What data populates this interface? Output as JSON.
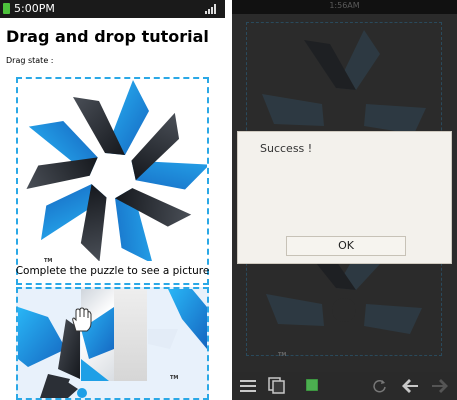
{
  "left_screen": {
    "status_bar": {
      "time": "5:00PM"
    },
    "title": "Drag and drop tutorial",
    "drag_state_label": "Drag state :",
    "caption": "Complete the puzzle to see a picture",
    "trademark": "TM",
    "colors": {
      "accent": "#2aa8e6",
      "puzzle_blue": "#1e9fe6",
      "puzzle_dark": "#2b2f36"
    }
  },
  "right_screen": {
    "status_bar": {
      "time": "1:56AM"
    },
    "dialog": {
      "message": "Success !",
      "ok_label": "OK"
    },
    "trademark": "TM",
    "bottom_bar_icons": [
      "menu-icon",
      "copy-icon",
      "app-icon",
      "refresh-icon",
      "back-icon",
      "forward-icon"
    ]
  }
}
